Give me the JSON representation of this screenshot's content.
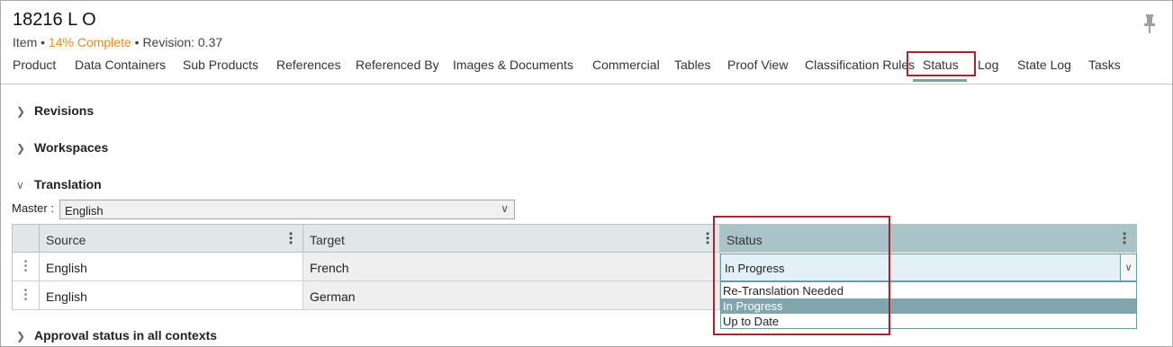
{
  "header": {
    "title": "18216 L O",
    "item_label": "Item",
    "complete": "14% Complete",
    "revision": "Revision: 0.37"
  },
  "tabs": [
    {
      "label": "Product"
    },
    {
      "label": "Data Containers"
    },
    {
      "label": "Sub Products"
    },
    {
      "label": "References"
    },
    {
      "label": "Referenced By"
    },
    {
      "label": "Images & Documents"
    },
    {
      "label": "Commercial"
    },
    {
      "label": "Tables"
    },
    {
      "label": "Proof View"
    },
    {
      "label": "Classification Rules"
    },
    {
      "label": "Status",
      "active": true
    },
    {
      "label": "Log"
    },
    {
      "label": "State Log"
    },
    {
      "label": "Tasks"
    }
  ],
  "sections": {
    "revisions": {
      "label": "Revisions",
      "expanded": false
    },
    "workspaces": {
      "label": "Workspaces",
      "expanded": false
    },
    "translation": {
      "label": "Translation",
      "expanded": true
    },
    "approval": {
      "label": "Approval status in all contexts",
      "expanded": false
    }
  },
  "translation": {
    "master_label": "Master :",
    "master_value": "English",
    "columns": [
      "Source",
      "Target",
      "Status"
    ],
    "rows": [
      {
        "source": "English",
        "target": "French",
        "status": "In Progress"
      },
      {
        "source": "English",
        "target": "German",
        "status": ""
      }
    ],
    "status_options": [
      "Re-Translation Needed",
      "In Progress",
      "Up to Date"
    ],
    "selected_option": "In Progress"
  },
  "colors": {
    "accent_orange": "#e88a1a",
    "highlight_red": "#a32632",
    "selected_teal": "#80a5ad",
    "header_teal": "#a9c3c8"
  },
  "icons": [
    "pin-icon",
    "chevron-right-icon",
    "chevron-down-icon",
    "kebab-menu-icon",
    "drag-handle-icon"
  ]
}
